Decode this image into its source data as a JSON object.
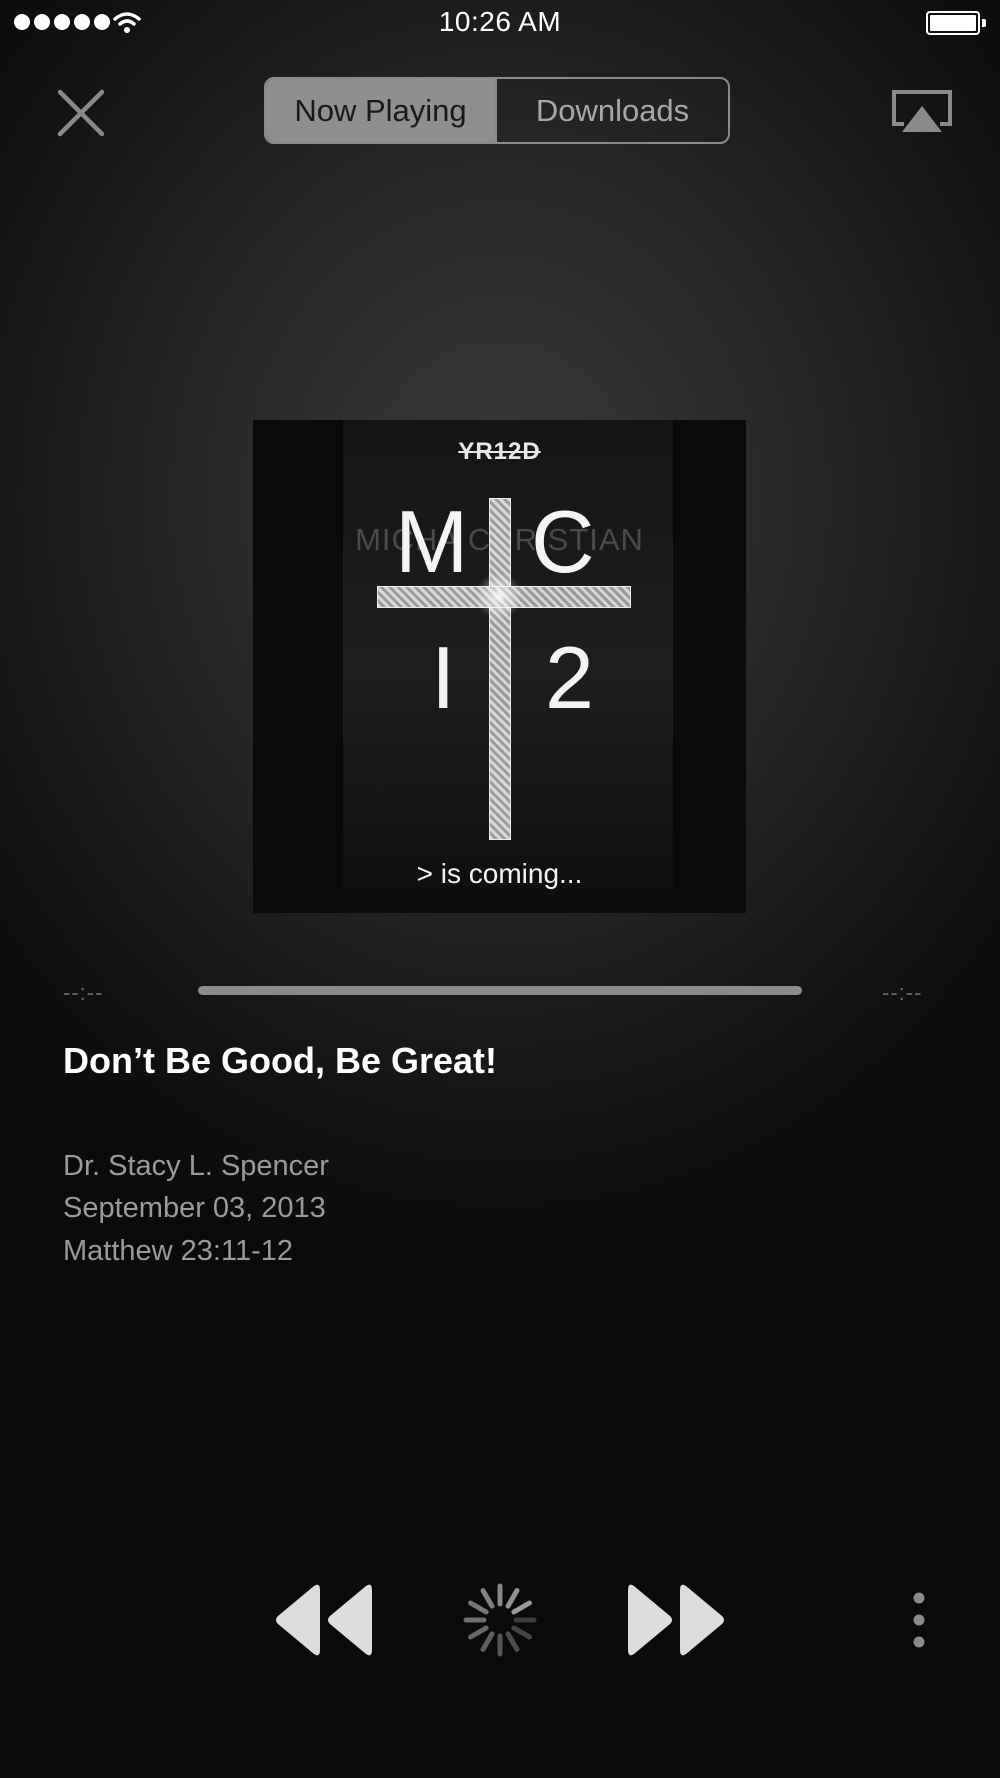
{
  "status_bar": {
    "time": "10:26 AM",
    "signal_dots": 5,
    "wifi_icon": "wifi-icon",
    "battery_icon": "battery-icon"
  },
  "top_bar": {
    "close_icon": "close-icon",
    "tabs": [
      {
        "label": "Now Playing",
        "selected": true
      },
      {
        "label": "Downloads",
        "selected": false
      }
    ],
    "airplay_icon": "airplay-icon"
  },
  "artwork": {
    "top_text": "YR12D",
    "faint_text": "MICHA CHRISTIAN",
    "letters": [
      "M",
      "C",
      "I",
      "2"
    ],
    "bottom_text": "> is coming..."
  },
  "progress": {
    "elapsed": "--:--",
    "remaining": "--:--"
  },
  "track": {
    "title": "Don’t Be Good, Be Great!",
    "speaker": "Dr. Stacy L. Spencer",
    "date": "September 03, 2013",
    "scripture": "Matthew 23:11-12"
  },
  "controls": {
    "rewind_icon": "rewind-icon",
    "loading_icon": "loading-spinner-icon",
    "forward_icon": "fast-forward-icon",
    "more_icon": "more-vertical-icon"
  },
  "colors": {
    "background": "#1e1e1e",
    "segment_active": "#8f8f8f",
    "secondary_text": "#9a9a9a",
    "control_fill": "#dcdcdc"
  }
}
